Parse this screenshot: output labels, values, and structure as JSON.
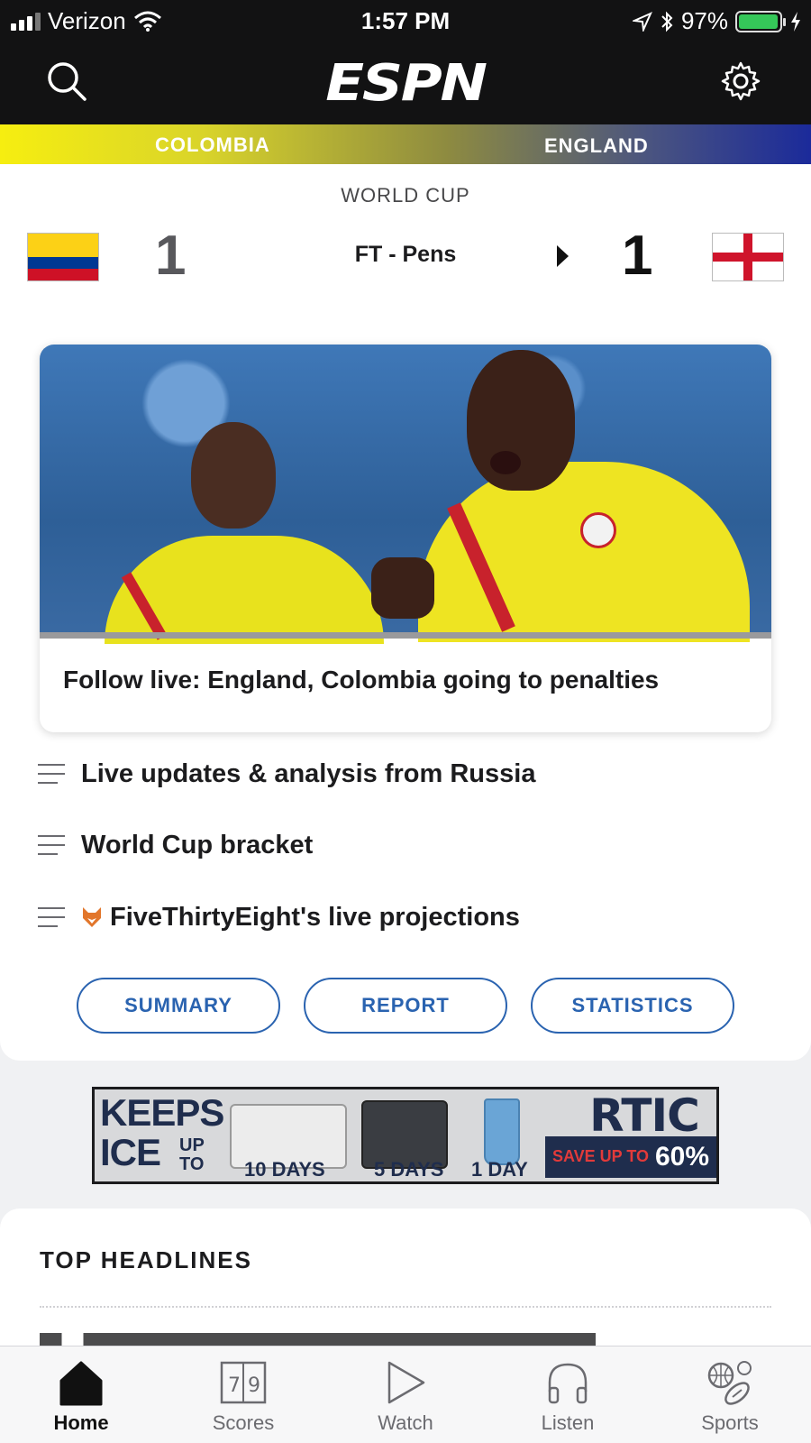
{
  "status_bar": {
    "carrier": "Verizon",
    "time": "1:57 PM",
    "battery": "97%",
    "battery_level": 0.97
  },
  "header": {
    "logo": "ESPN",
    "icons": [
      "search-icon",
      "gear-icon"
    ]
  },
  "match": {
    "home_team": "COLOMBIA",
    "away_team": "ENGLAND",
    "competition": "WORLD CUP",
    "home_score": "1",
    "away_score": "1",
    "status": "FT - Pens",
    "home_color": "#f6ee10",
    "away_color": "#1b2a9a"
  },
  "story": {
    "title": "Follow live: England, Colombia going to penalties"
  },
  "links": [
    {
      "label": "Live updates & analysis from Russia",
      "icon": "list-icon"
    },
    {
      "label": "World Cup bracket",
      "icon": "list-icon"
    },
    {
      "label": "FiveThirtyEight's live projections",
      "icon": "fox-icon"
    }
  ],
  "buttons": {
    "summary": "SUMMARY",
    "report": "REPORT",
    "statistics": "STATISTICS"
  },
  "ad": {
    "keeps": "KEEPS",
    "ice": "ICE",
    "up_to": "UP TO",
    "days_10": "10 DAYS",
    "days_5": "5 DAYS",
    "day_1": "1 DAY",
    "brand": "RTIC",
    "save": "SAVE UP TO",
    "percent": "60%"
  },
  "headlines": {
    "title": "TOP HEADLINES"
  },
  "tabbar": {
    "home": "Home",
    "scores": "Scores",
    "watch": "Watch",
    "listen": "Listen",
    "sports": "Sports",
    "active": "Home"
  },
  "colors": {
    "accent": "#2a63b0",
    "header_bg": "#121213"
  }
}
